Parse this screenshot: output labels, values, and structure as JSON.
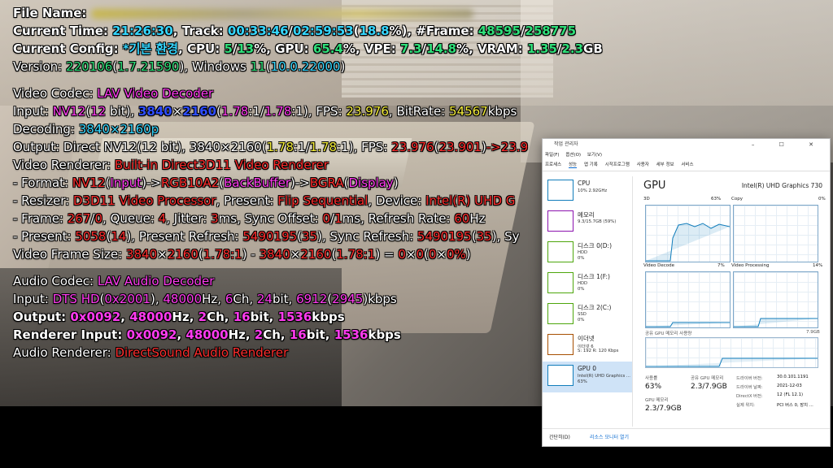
{
  "osd": {
    "file": {
      "label": "File Name:"
    },
    "time": {
      "label": "Current Time:",
      "clock": "21:26:30",
      "track_label": "Track:",
      "pos": "00:33:46",
      "dur": "02:59:53",
      "pct": "18.8",
      "frame_label": "#Frame:",
      "frame": "48595",
      "frames": "258775"
    },
    "config": {
      "label": "Current Config:",
      "name": "*기본 환경",
      "cpu_label": "CPU:",
      "cpu1": "5",
      "cpu2": "13",
      "gpu_label": "GPU:",
      "gpu": "65.4",
      "vpe_label": "VPE:",
      "vpe1": "7.3",
      "vpe2": "14.8",
      "vram_label": "VRAM:",
      "vram1": "1.35",
      "vram2": "2.3"
    },
    "version": {
      "label": "Version:",
      "ver": "220106",
      "build": "1.7.21590",
      "os": "Windows",
      "os_ver": "11",
      "os_build": "10.0.22000"
    },
    "vcodec": {
      "label": "Video Codec:",
      "value": "LAV Video Decoder"
    },
    "vinput": {
      "label": "Input:",
      "fmt": "NV12",
      "bits": "12",
      "bit_word": "bit",
      "w": "3840",
      "h": "2160",
      "ar1": "1.78",
      "ar2": "1.78",
      "fps_label": "FPS:",
      "fps": "23.976",
      "br_label": "BitRate:",
      "br": "54567",
      "br_unit": "kbps"
    },
    "decoding": {
      "label": "Decoding:",
      "value": "3840×2160p"
    },
    "voutput": {
      "label": "Output: Direct NV12(12 bit), 3840×2160(",
      "ar1": "1.78",
      "ar2": "1.78",
      "fps_label": "FPS:",
      "fps": "23.976",
      "fps2": "23.901",
      "tail": "->23.9"
    },
    "vrenderer": {
      "label": "Video Renderer:",
      "value": "Built-in Direct3D11 Video Renderer"
    },
    "format": {
      "label": " - Format:",
      "a": "NV12",
      "ai": "Input",
      "b": "RGB10A2",
      "bi": "BackBuffer",
      "c": "BGRA",
      "ci": "Display"
    },
    "resizer": {
      "label": " - Resizer:",
      "value": "D3D11 Video Processor",
      "present_label": "Present:",
      "present": "Flip Sequential",
      "device_label": "Device:",
      "device": "Intel(R) UHD G"
    },
    "frame": {
      "label": " - Frame:",
      "f1": "267",
      "f2": "0",
      "queue_label": "Queue:",
      "queue": "4",
      "jitter_label": "Jitter:",
      "jitter": "3",
      "ms": "ms",
      "sync_label": "Sync Offset:",
      "s1": "0",
      "s2": "1",
      "refresh_label": "Refresh Rate:",
      "refresh": "60",
      "hz": "Hz"
    },
    "present": {
      "label": " - Present:",
      "p1": "5058",
      "p2": "14",
      "pr_label": "Present Refresh:",
      "pr1": "5490195",
      "pr2": "35",
      "sr_label": "Sync Refresh:",
      "sr1": "5490195",
      "sr2": "35",
      "tail": "Sy"
    },
    "framesize": {
      "label": "Video Frame Size:",
      "w1": "3840",
      "h1": "2160",
      "ar1": "1.78:1",
      "w2": "3840",
      "h2": "2160",
      "ar2": "1.78:1",
      "d1": "0",
      "d2": "0",
      "d3": "0",
      "d4": "0%"
    },
    "acodec": {
      "label": "Audio Codec:",
      "value": "LAV Audio Decoder"
    },
    "ainput": {
      "label": "Input:",
      "fmt": "DTS HD",
      "id": "0x2001",
      "hz": "48000",
      "hz_unit": "Hz,",
      "ch": "6",
      "ch_unit": "Ch,",
      "bit": "24",
      "bit_unit": "bit,",
      "br1": "6912",
      "br2": "2945",
      "br_unit": "kbps"
    },
    "aoutput": {
      "label": "Output:",
      "fmt": "0x0092",
      "hz": "48000",
      "hz_unit": "Hz,",
      "ch": "2",
      "ch_unit": "Ch,",
      "bit": "16",
      "bit_unit": "bit,",
      "br": "1536",
      "br_unit": "kbps"
    },
    "rinput": {
      "label": "Renderer Input:",
      "fmt": "0x0092",
      "hz": "48000",
      "hz_unit": "Hz,",
      "ch": "2",
      "ch_unit": "Ch,",
      "bit": "16",
      "bit_unit": "bit,",
      "br": "1536",
      "br_unit": "kbps"
    },
    "arenderer": {
      "label": "Audio Renderer:",
      "value": "DirectSound Audio Renderer"
    }
  },
  "taskmgr": {
    "title": "작업 관리자",
    "controls": "–  ☐  ✕",
    "menu": [
      "파일(F)",
      "옵션(O)",
      "보기(V)"
    ],
    "tabs": [
      "프로세스",
      "성능",
      "앱 기록",
      "시작프로그램",
      "사용자",
      "세부 정보",
      "서비스"
    ],
    "resources": [
      {
        "name": "CPU",
        "d1": "10%  2.92GHz",
        "d2": "",
        "color": "#117dbb"
      },
      {
        "name": "메모리",
        "d1": "9.3/15.7GB (59%)",
        "d2": "",
        "color": "#8b12ae"
      },
      {
        "name": "디스크 0(D:)",
        "d1": "HDD",
        "d2": "0%",
        "color": "#4da60c"
      },
      {
        "name": "디스크 1(F:)",
        "d1": "HDD",
        "d2": "0%",
        "color": "#4da60c"
      },
      {
        "name": "디스크 2(C:)",
        "d1": "SSD",
        "d2": "0%",
        "color": "#4da60c"
      },
      {
        "name": "이더넷",
        "d1": "이더넷 6",
        "d2": "S: 192  R: 120 Kbps",
        "color": "#a74f01"
      },
      {
        "name": "GPU 0",
        "d1": "Intel(R) UHD Graphics ...",
        "d2": "63%",
        "color": "#117dbb"
      }
    ],
    "gpu": {
      "title": "GPU",
      "name": "Intel(R) UHD Graphics 730",
      "g1_label": "3D",
      "g1_pct": "63%",
      "g2_label": "Copy",
      "g2_pct": "0%",
      "g3_label": "Video Decode",
      "g3_pct": "7%",
      "g4_label": "Video Processing",
      "g4_pct": "14%",
      "shared_label": "공유 GPU 메모리 사용량",
      "shared_max": "7.9GB",
      "usage_label": "사용률",
      "usage": "63%",
      "shared2_label": "공유 GPU 메모리",
      "shared2": "2.3/7.9GB",
      "gmem_label": "GPU 메모리",
      "gmem": "2.3/7.9GB",
      "driver_ver_label": "드라이버 버전:",
      "driver_ver": "30.0.101.1191",
      "driver_date_label": "드라이버 날짜:",
      "driver_date": "2021-12-03",
      "directx_label": "DirectX 버전:",
      "directx": "12 (FL 12.1)",
      "loc_label": "실제 위치:",
      "loc": "PCI 버스 0, 장치 ..."
    },
    "footer": {
      "less": "간단히(D)",
      "monitor": "리소스 모니터 열기"
    }
  }
}
